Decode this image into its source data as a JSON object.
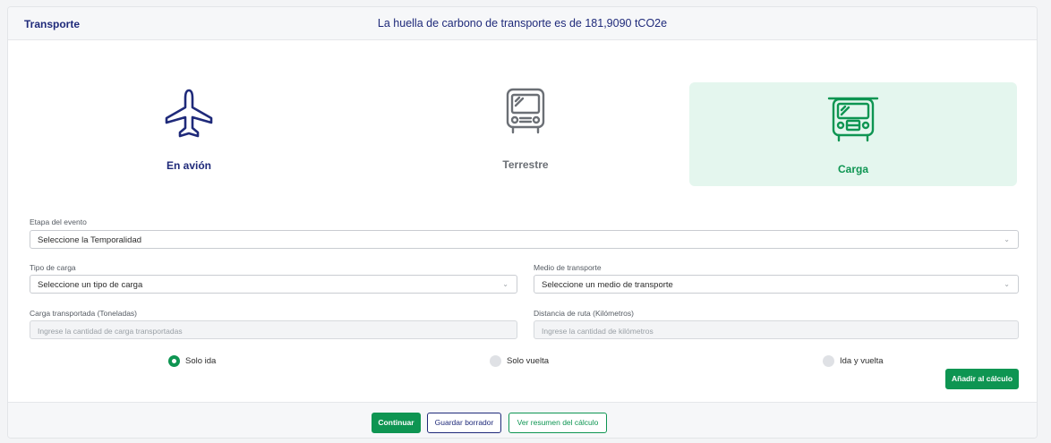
{
  "header": {
    "title": "Transporte",
    "headline": "La huella de carbono de transporte es de 181,9090 tCO2e"
  },
  "modes": [
    {
      "label": "En avión",
      "icon": "airplane-icon",
      "color": "#1f2a7a"
    },
    {
      "label": "Terrestre",
      "icon": "bus-icon",
      "color": "#6b6f75"
    },
    {
      "label": "Carga",
      "icon": "cargo-truck-icon",
      "color": "#0e9552",
      "selected": true
    }
  ],
  "form": {
    "etapa": {
      "label": "Etapa del evento",
      "value": "Seleccione la Temporalidad"
    },
    "tipo_carga": {
      "label": "Tipo de carga",
      "value": "Seleccione un tipo de carga"
    },
    "medio": {
      "label": "Medio de transporte",
      "value": "Seleccione un medio de transporte"
    },
    "carga": {
      "label": "Carga transportada (Toneladas)",
      "placeholder": "Ingrese la cantidad de carga transportadas"
    },
    "distancia": {
      "label": "Distancia de ruta (Kilómetros)",
      "placeholder": "Ingrese la cantidad de kilómetros"
    },
    "trip_options": [
      {
        "label": "Solo ida",
        "selected": true
      },
      {
        "label": "Solo vuelta",
        "selected": false
      },
      {
        "label": "Ida y vuelta",
        "selected": false
      }
    ],
    "add_label": "Añadir al cálculo"
  },
  "footer": {
    "continue_label": "Continuar",
    "draft_label": "Guardar borrador",
    "summary_label": "Ver resumen del cálculo"
  },
  "colors": {
    "accent": "#0e9552",
    "navy": "#1f2a7a",
    "selected_bg": "#e4f6ee"
  }
}
